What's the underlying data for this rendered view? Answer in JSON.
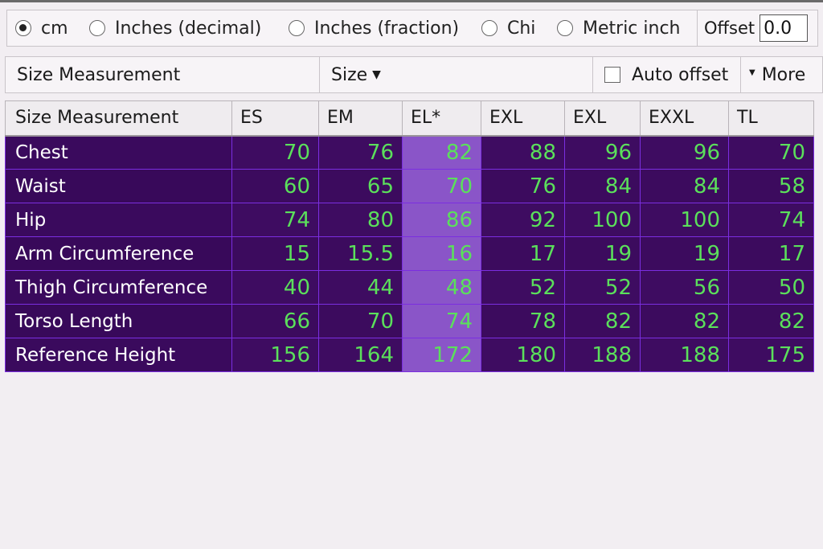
{
  "units": {
    "options": [
      {
        "label": "cm",
        "checked": true
      },
      {
        "label": "Inches (decimal)",
        "checked": false
      },
      {
        "label": "Inches (fraction)",
        "checked": false
      },
      {
        "label": "Chi",
        "checked": false
      },
      {
        "label": "Metric inch",
        "checked": false
      }
    ],
    "offset_label": "Offset",
    "offset_value": "0.0"
  },
  "header": {
    "measurement_label": "Size Measurement",
    "size_label": "Size",
    "auto_offset_label": "Auto offset",
    "more_label": "More"
  },
  "table": {
    "columns": [
      "Size Measurement",
      "ES",
      "EM",
      "EL*",
      "EXL",
      "EXL",
      "EXXL",
      "TL"
    ],
    "selected_column": 3,
    "rows": [
      {
        "label": "Chest",
        "values": [
          "70",
          "76",
          "82",
          "88",
          "96",
          "96",
          "70"
        ]
      },
      {
        "label": "Waist",
        "values": [
          "60",
          "65",
          "70",
          "76",
          "84",
          "84",
          "58"
        ]
      },
      {
        "label": "Hip",
        "values": [
          "74",
          "80",
          "86",
          "92",
          "100",
          "100",
          "74"
        ]
      },
      {
        "label": "Arm Circumference",
        "values": [
          "15",
          "15.5",
          "16",
          "17",
          "19",
          "19",
          "17"
        ]
      },
      {
        "label": "Thigh Circumference",
        "values": [
          "40",
          "44",
          "48",
          "52",
          "52",
          "56",
          "50"
        ]
      },
      {
        "label": "Torso Length",
        "values": [
          "66",
          "70",
          "74",
          "78",
          "82",
          "82",
          "82"
        ]
      },
      {
        "label": "Reference Height",
        "values": [
          "156",
          "164",
          "172",
          "180",
          "188",
          "188",
          "175"
        ]
      }
    ]
  },
  "colors": {
    "cell_bg": "#3c0b5e",
    "selected_bg": "#8a55c8",
    "value_text": "#5be05b",
    "grid_line": "#7b2ee0"
  }
}
